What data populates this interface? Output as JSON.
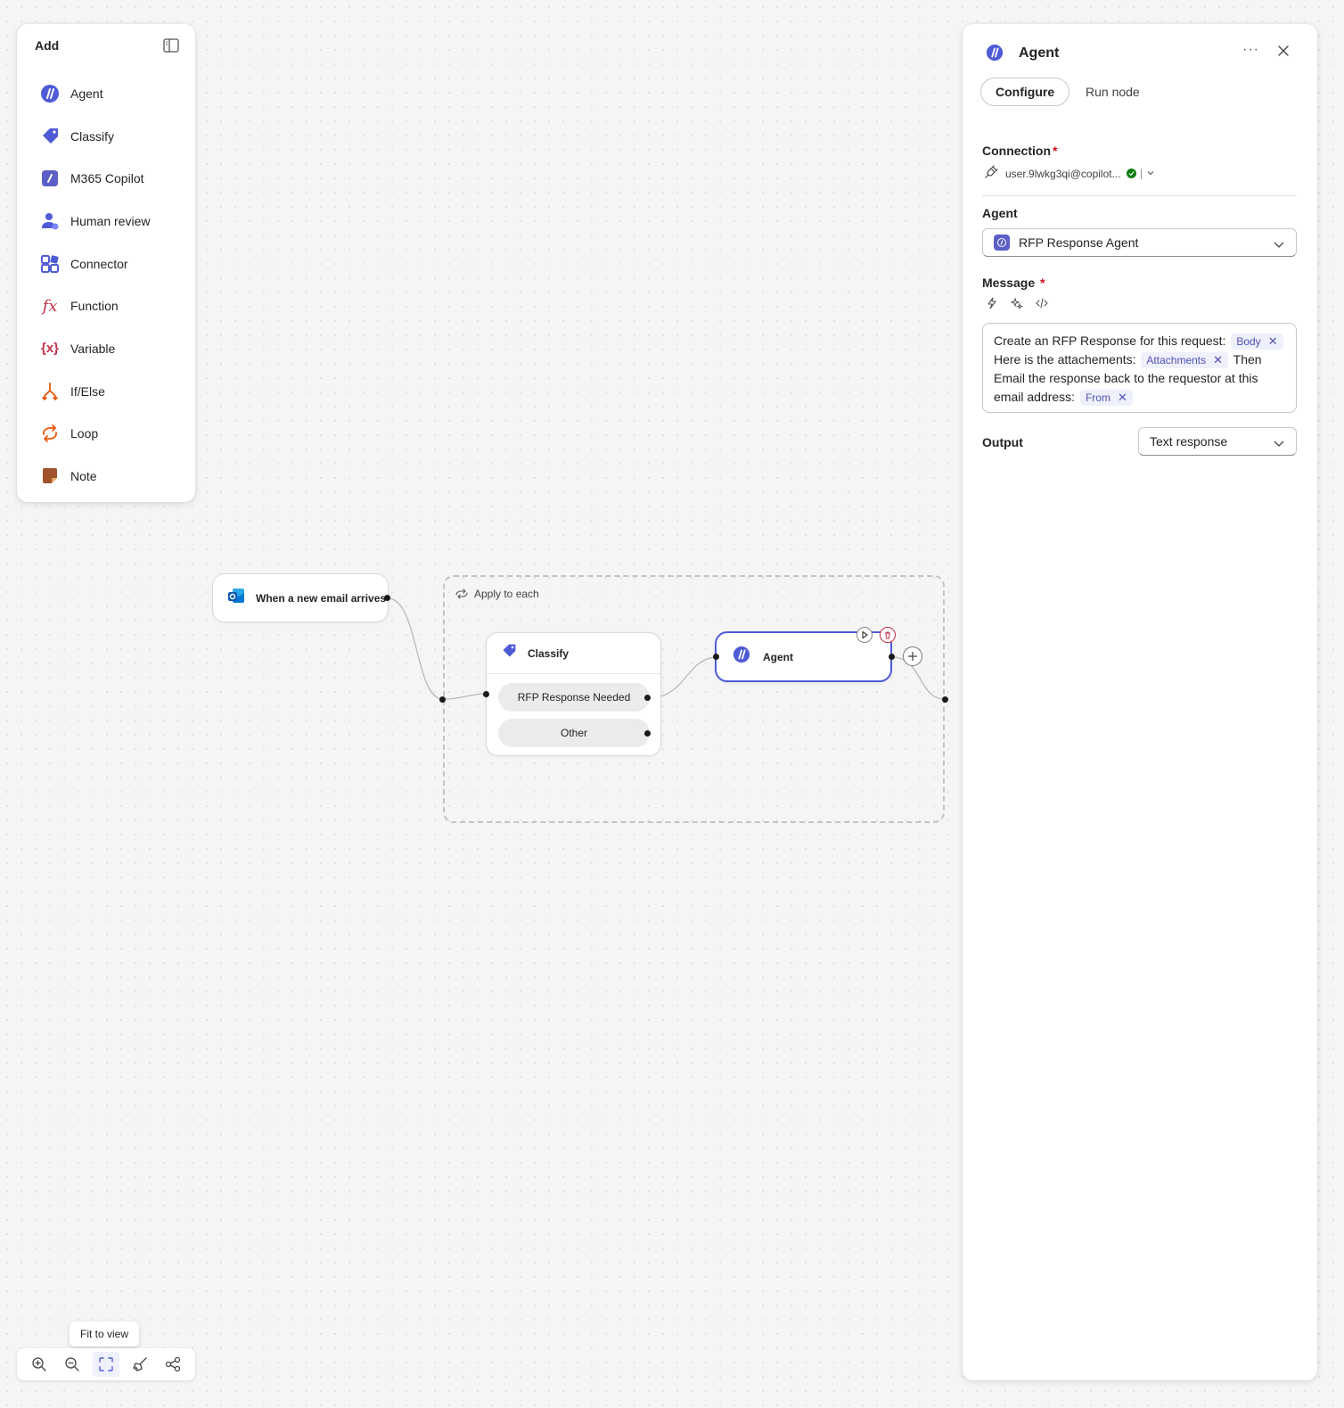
{
  "add_panel": {
    "title": "Add",
    "items": [
      {
        "label": "Agent",
        "icon": "agent-icon"
      },
      {
        "label": "Classify",
        "icon": "classify-icon"
      },
      {
        "label": "M365 Copilot",
        "icon": "m365-copilot-icon"
      },
      {
        "label": "Human review",
        "icon": "human-review-icon"
      },
      {
        "label": "Connector",
        "icon": "connector-icon"
      },
      {
        "label": "Function",
        "icon": "function-icon"
      },
      {
        "label": "Variable",
        "icon": "variable-icon"
      },
      {
        "label": "If/Else",
        "icon": "if-else-icon"
      },
      {
        "label": "Loop",
        "icon": "loop-icon"
      },
      {
        "label": "Note",
        "icon": "note-icon"
      }
    ]
  },
  "canvas": {
    "trigger": {
      "label": "When a new email arrives"
    },
    "loop": {
      "label": "Apply to each"
    },
    "classify": {
      "label": "Classify",
      "branches": [
        "RFP Response Needed",
        "Other"
      ]
    },
    "agent": {
      "label": "Agent"
    }
  },
  "toolbar": {
    "tooltip": "Fit to view",
    "buttons": [
      "zoom-in",
      "zoom-out",
      "fit-to-view",
      "tidy-up",
      "auto-layout"
    ]
  },
  "panel": {
    "title": "Agent",
    "tabs": {
      "configure": "Configure",
      "run": "Run node"
    },
    "connection": {
      "label": "Connection",
      "required": "*",
      "account": "user.9lwkg3qi@copilot..."
    },
    "agent_field": {
      "label": "Agent",
      "value": "RFP Response Agent"
    },
    "message": {
      "label": "Message",
      "required": "*",
      "part1": "Create an RFP Response for this request:",
      "token1": "Body",
      "part2": "Here is the attachements:",
      "token2": "Attachments",
      "part3": "Then Email the response back to the requestor at this email address:",
      "token3": "From"
    },
    "output": {
      "label": "Output",
      "value": "Text response"
    }
  },
  "colors": {
    "accent": "#4f5bd5",
    "required": "#c50f1f",
    "success": "#107c10"
  }
}
